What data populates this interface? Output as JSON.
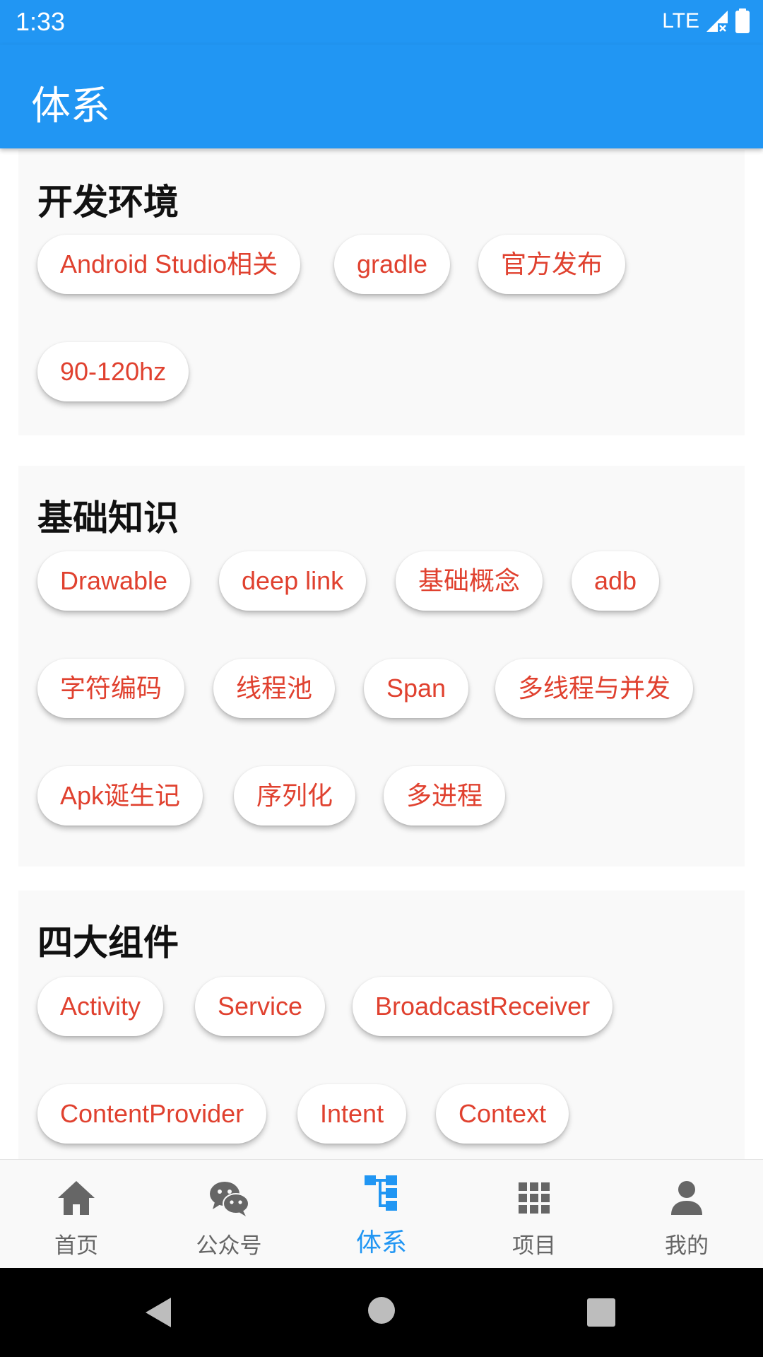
{
  "status": {
    "time": "1:33",
    "network": "LTE"
  },
  "app_bar": {
    "title": "体系"
  },
  "sections": [
    {
      "title": "开发环境",
      "chips": [
        "Android Studio相关",
        "gradle",
        "官方发布",
        "90-120hz"
      ]
    },
    {
      "title": "基础知识",
      "chips": [
        "Drawable",
        "deep link",
        "基础概念",
        "adb",
        "字符编码",
        "线程池",
        "Span",
        "多线程与并发",
        "Apk诞生记",
        "序列化",
        "多进程"
      ]
    },
    {
      "title": "四大组件",
      "chips": [
        "Activity",
        "Service",
        "BroadcastReceiver",
        "ContentProvider",
        "Intent",
        "Context"
      ]
    }
  ],
  "bottom_nav": [
    {
      "label": "首页",
      "icon": "home-icon",
      "active": false
    },
    {
      "label": "公众号",
      "icon": "wechat-icon",
      "active": false
    },
    {
      "label": "体系",
      "icon": "tree-icon",
      "active": true
    },
    {
      "label": "项目",
      "icon": "grid-icon",
      "active": false
    },
    {
      "label": "我的",
      "icon": "person-icon",
      "active": false
    }
  ],
  "colors": {
    "primary": "#2196f3",
    "chip_text": "#e0412f",
    "nav_inactive": "#666666"
  }
}
